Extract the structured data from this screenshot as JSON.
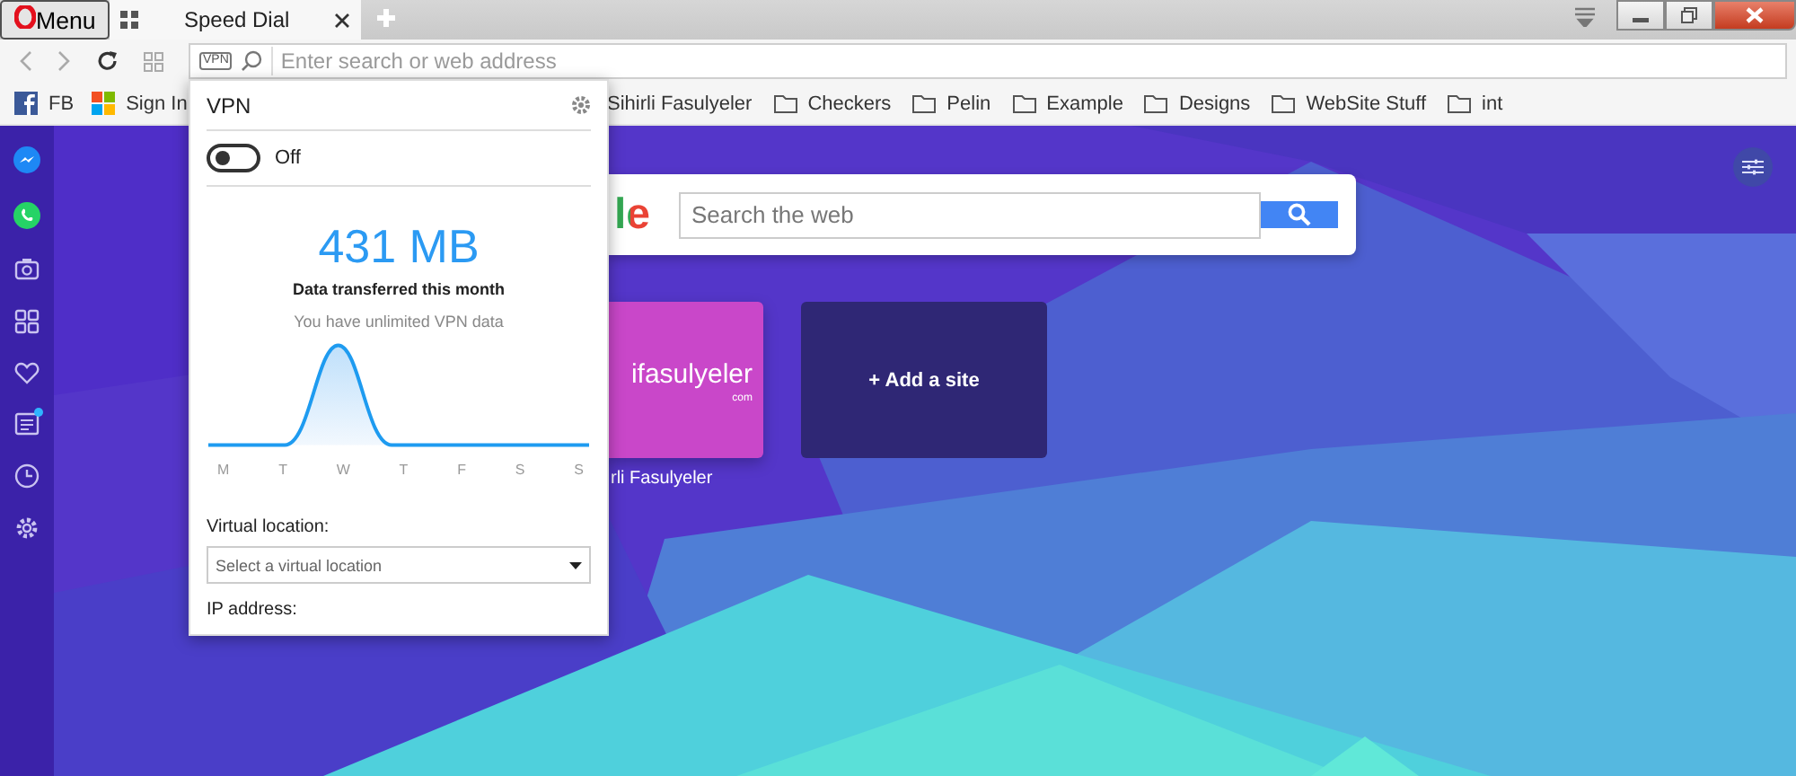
{
  "tab_bar": {
    "menu": "Menu",
    "tabs": [
      {
        "title": "Speed Dial",
        "selected": true
      }
    ]
  },
  "address_bar": {
    "badge": "VPN",
    "placeholder": "Enter search or web address"
  },
  "bookmarks_left": [
    {
      "label": "FB"
    },
    {
      "label": "Sign In"
    }
  ],
  "bookmarks_right": [
    {
      "label": "Sihirli Fasulyeler"
    },
    {
      "label": "Checkers"
    },
    {
      "label": "Pelin"
    },
    {
      "label": "Example"
    },
    {
      "label": "Designs"
    },
    {
      "label": "WebSite Stuff"
    },
    {
      "label": "int"
    }
  ],
  "sidebar": {
    "unread_dot": true
  },
  "speed_dial": {
    "logo_fragment": "le",
    "search_placeholder": "Search the web",
    "tiles": [
      {
        "kind": "site",
        "logo": "ifasulyeler",
        "logo_suffix": "com",
        "label": "rli Fasulyeler"
      },
      {
        "kind": "add",
        "label": "+ Add a site"
      }
    ]
  },
  "vpn_popup": {
    "title": "VPN",
    "enabled": false,
    "toggle_label": "Off",
    "data_amount": "431 MB",
    "data_caption": "Data transferred this month",
    "data_note": "You have unlimited VPN data",
    "days": [
      "M",
      "T",
      "W",
      "T",
      "F",
      "S",
      "S"
    ],
    "location_label": "Virtual location:",
    "location_placeholder": "Select a virtual location",
    "ip_label": "IP address:"
  }
}
